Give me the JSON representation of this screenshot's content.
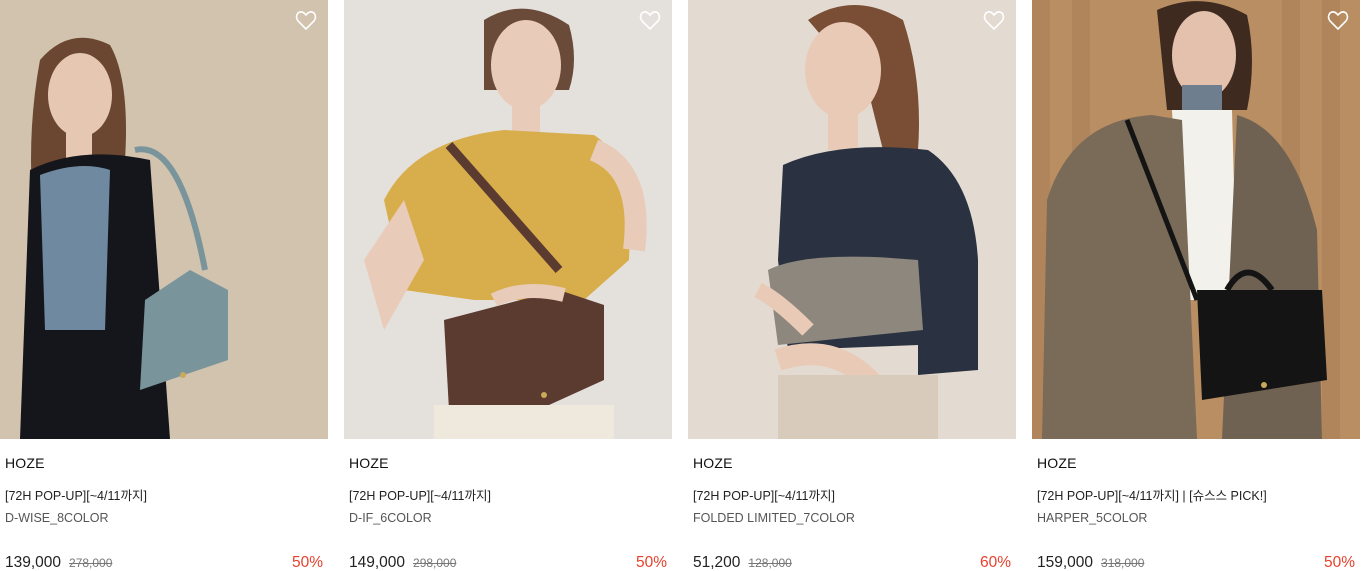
{
  "products": [
    {
      "brand": "HOZE",
      "promo": "[72H POP-UP][~4/11까지]",
      "name": "D-WISE_8COLOR",
      "price": "139,000",
      "original_price": "278,000",
      "discount": "50%",
      "colors": {
        "bg": "#d8cbb7",
        "bg2": "#c6b49b",
        "top": "#6f8aa0",
        "coat": "#15161c",
        "bag": "#7a949c",
        "hair": "#6b4630",
        "skin": "#e6c7b1"
      }
    },
    {
      "brand": "HOZE",
      "promo": "[72H POP-UP][~4/11까지]",
      "name": "D-IF_6COLOR",
      "price": "149,000",
      "original_price": "298,000",
      "discount": "50%",
      "colors": {
        "bg": "#e4e1dd",
        "bg2": "#d9d4cf",
        "top": "#d8ae4c",
        "coat": "#efe8dc",
        "bag": "#5b3a30",
        "hair": "#6a4a38",
        "skin": "#e8cbb8"
      }
    },
    {
      "brand": "HOZE",
      "promo": "[72H POP-UP][~4/11까지]",
      "name": "FOLDED LIMITED_7COLOR",
      "price": "51,200",
      "original_price": "128,000",
      "discount": "60%",
      "colors": {
        "bg": "#e3dbd1",
        "bg2": "#d8cec2",
        "top": "#2a3140",
        "coat": "#d9cbbb",
        "bag": "#8d877d",
        "hair": "#7a4e34",
        "skin": "#e9cab6"
      }
    },
    {
      "brand": "HOZE",
      "promo": "[72H POP-UP][~4/11까지] | [슈스스 PICK!]",
      "name": "HARPER_5COLOR",
      "price": "159,000",
      "original_price": "318,000",
      "discount": "50%",
      "colors": {
        "bg": "#b98e62",
        "bg2": "#a47650",
        "top": "#7a6a58",
        "coat": "#6f6253",
        "bag": "#141414",
        "hair": "#3f2a20",
        "skin": "#e3c1ad"
      }
    }
  ],
  "icons": {
    "wishlist": "heart-outline-icon"
  },
  "accent": {
    "discount": "#e8412c"
  }
}
